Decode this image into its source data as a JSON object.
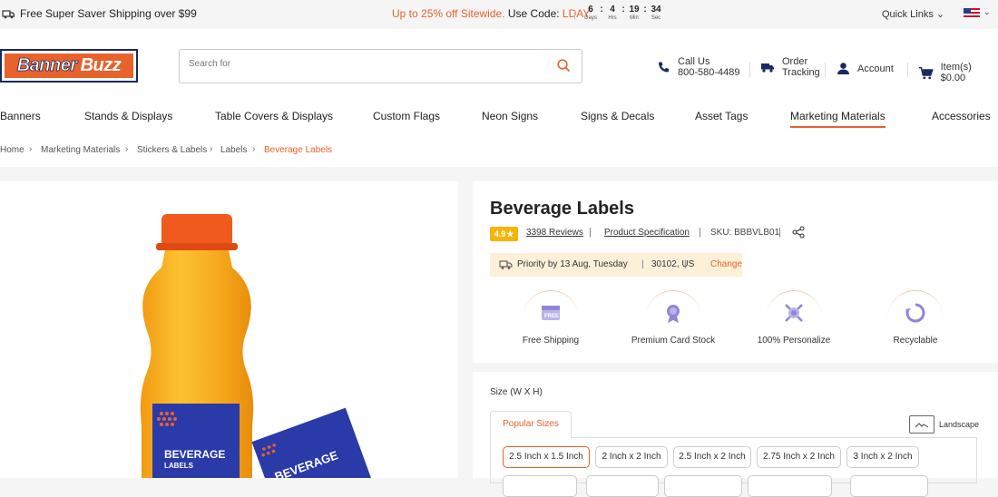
{
  "topbar": {
    "shipping": "Free Super Saver Shipping over $99",
    "promo": "Up to 25% off Sitewide.",
    "code_label": "Use Code:",
    "code": "LDAY",
    "countdown": [
      {
        "value": "6",
        "label": "Days"
      },
      {
        "value": "4",
        "label": "Hrs"
      },
      {
        "value": "19",
        "label": "Min"
      },
      {
        "value": "34",
        "label": "Sec"
      }
    ],
    "quick_links": "Quick Links"
  },
  "header": {
    "logo_word1": "Banner",
    "logo_word2": "Buzz",
    "search_placeholder": "Search for",
    "call_label": "Call Us",
    "call_number": "800-580-4489",
    "order_label1": "Order",
    "order_label2": "Tracking",
    "account": "Account",
    "cart": "Item(s) $0.00"
  },
  "nav": {
    "items": [
      "Banners",
      "Stands & Displays",
      "Table Covers & Displays",
      "Custom Flags",
      "Neon Signs",
      "Signs & Decals",
      "Asset Tags",
      "Marketing Materials",
      "Accessories"
    ],
    "active": "Marketing Materials"
  },
  "breadcrumb": [
    "Home",
    "Marketing Materials",
    "Stickers & Labels",
    "Labels",
    "Beverage Labels"
  ],
  "product": {
    "title": "Beverage Labels",
    "rating": "4.9",
    "reviews": "3398 Reviews",
    "spec_link": "Product Specification",
    "sku": "SKU: BBBVLB01",
    "delivery": "Priority by 13 Aug, Tuesday",
    "zip": "30102, US",
    "change": "Change",
    "label_line1": "BEVERAGE",
    "label_line2": "LABELS",
    "card_text": "BEVERAGE",
    "features": [
      {
        "icon": "free-shipping-icon",
        "label": "Free Shipping"
      },
      {
        "icon": "premium-card-stock-icon",
        "label": "Premium Card Stock"
      },
      {
        "icon": "personalize-icon",
        "label": "100% Personalize"
      },
      {
        "icon": "recyclable-icon",
        "label": "Recyclable"
      }
    ]
  },
  "sizes": {
    "heading": "Size (W X H)",
    "tab": "Popular Sizes",
    "orientation": "Landscape",
    "options": [
      "2.5 Inch x 1.5 Inch",
      "2 Inch x 2 Inch",
      "2.5 Inch x 2 Inch",
      "2.75 Inch x 2 Inch",
      "3 Inch x 2 Inch"
    ],
    "selected": "2.5 Inch x 1.5 Inch"
  },
  "colors": {
    "accent": "#e8622c",
    "navy": "#1a2a5e",
    "rating": "#f5b40a",
    "delivery_bg": "#fdf0d9"
  }
}
